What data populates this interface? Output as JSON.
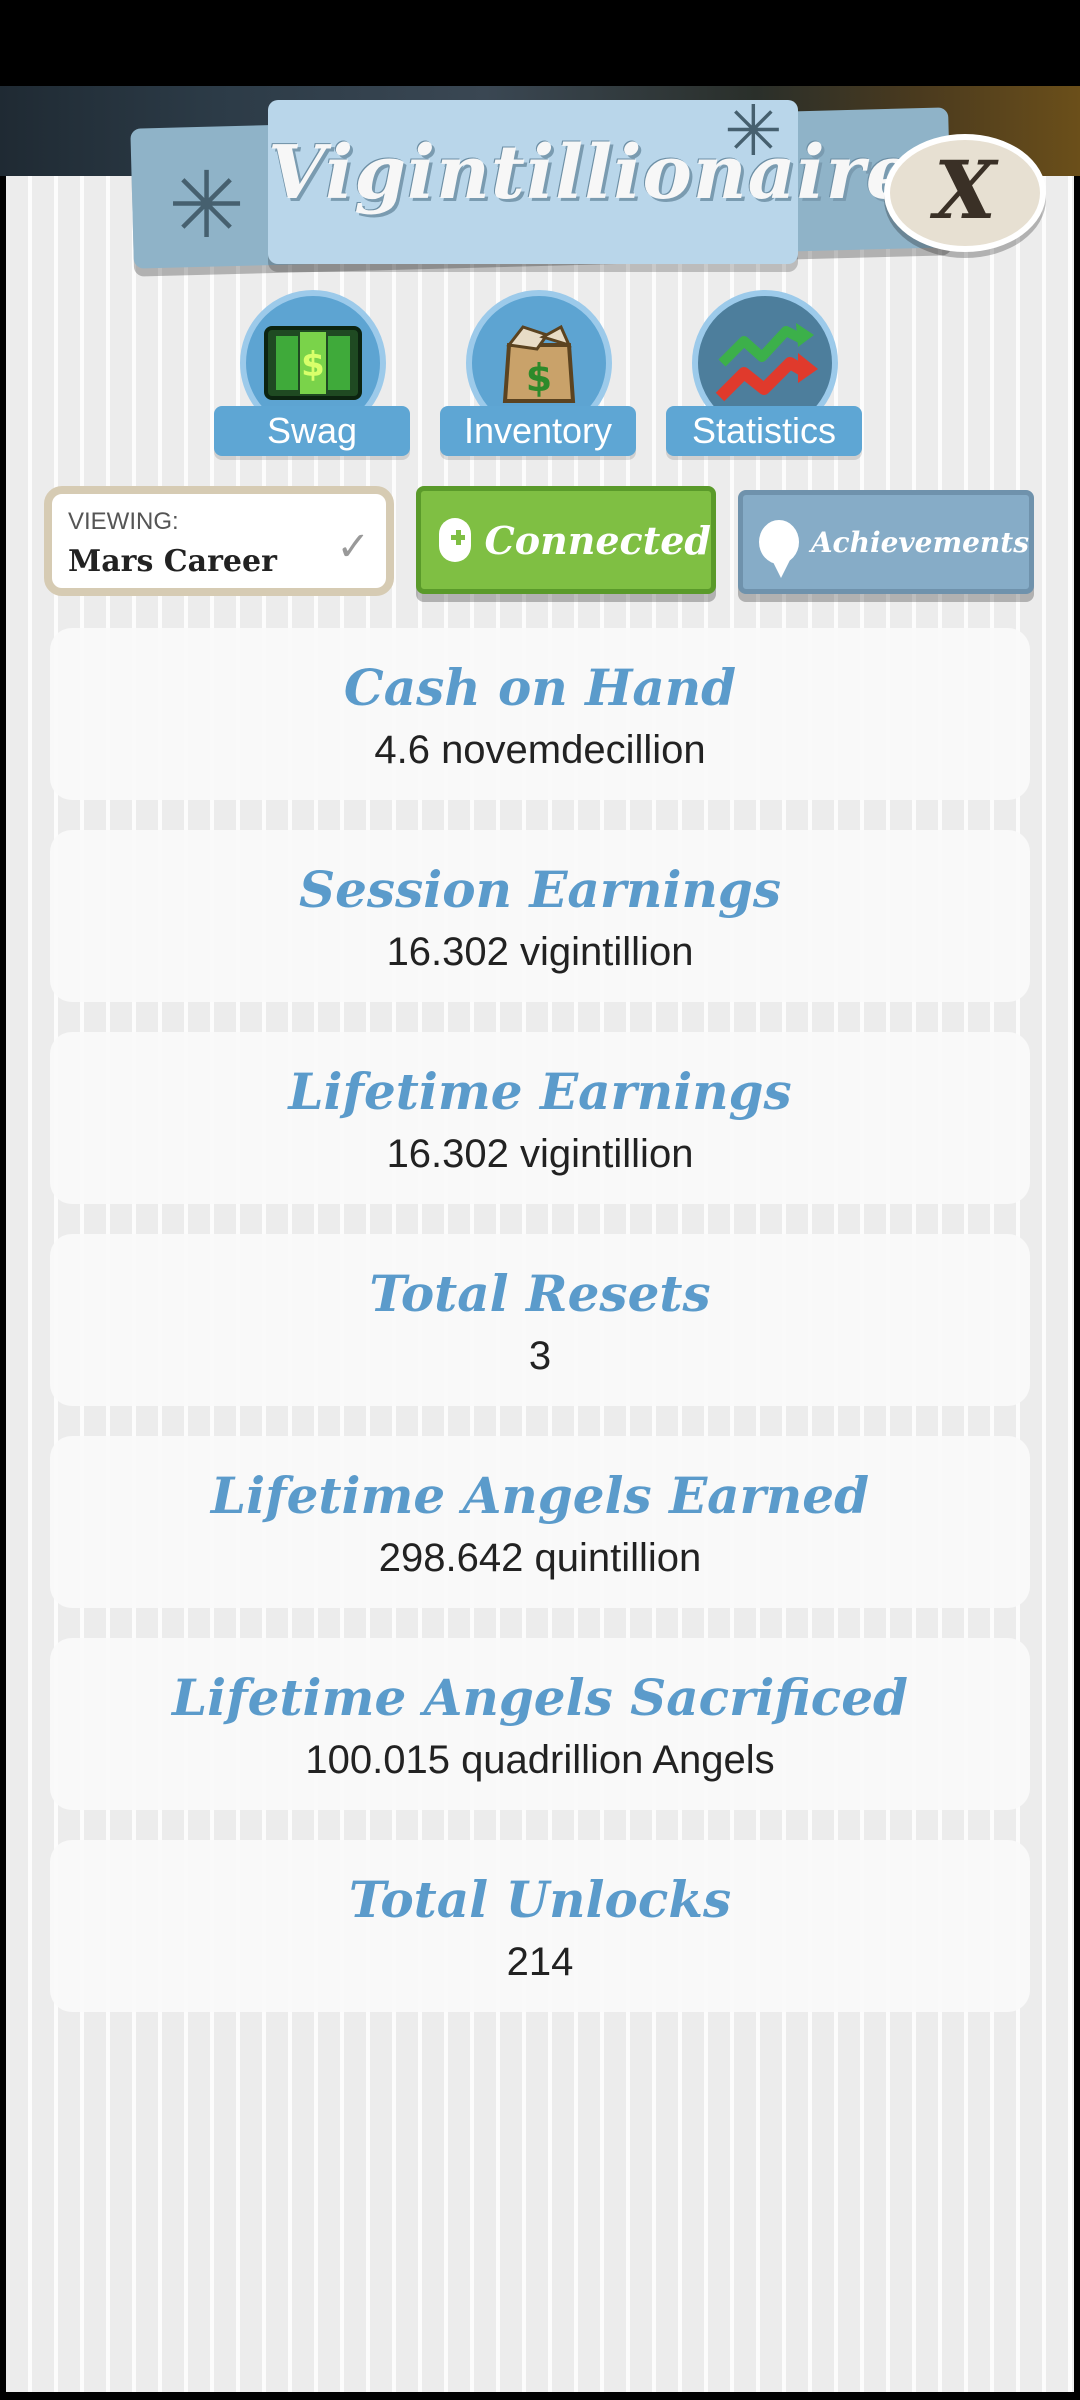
{
  "header": {
    "title": "Vigintillionaire!",
    "close_label": "X"
  },
  "tabs": [
    {
      "label": "Swag",
      "icon": "money-icon"
    },
    {
      "label": "Inventory",
      "icon": "box-icon"
    },
    {
      "label": "Statistics",
      "icon": "chart-arrows-icon"
    }
  ],
  "viewing": {
    "label": "VIEWING:",
    "value": "Mars Career"
  },
  "buttons": {
    "connected": "Connected",
    "achievements": "Achievements"
  },
  "stats": [
    {
      "title": "Cash on Hand",
      "value": "4.6 novemdecillion"
    },
    {
      "title": "Session Earnings",
      "value": "16.302 vigintillion"
    },
    {
      "title": "Lifetime Earnings",
      "value": "16.302 vigintillion"
    },
    {
      "title": "Total Resets",
      "value": "3"
    },
    {
      "title": "Lifetime Angels Earned",
      "value": "298.642 quintillion"
    },
    {
      "title": "Lifetime Angels Sacrificed",
      "value": "100.015 quadrillion Angels"
    },
    {
      "title": "Total Unlocks",
      "value": "214"
    }
  ],
  "colors": {
    "accent_blue": "#5b9bcb",
    "connected_green": "#7fbf43",
    "achievements_blue": "#86acc7"
  }
}
